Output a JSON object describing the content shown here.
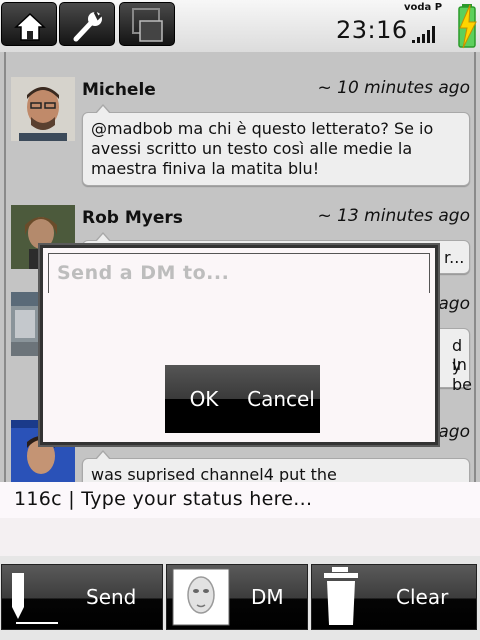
{
  "statusbar": {
    "clock": "23:16",
    "carrier": "voda P"
  },
  "topbar": {
    "home_icon": "home-icon",
    "settings_icon": "wrench-icon",
    "third_icon": "window-icon"
  },
  "tweets": [
    {
      "author": "Michele",
      "time": "~ 10 minutes ago",
      "text": "@madbob ma chi è questo letterato? Se io avessi scritto un testo così alle medie la maestra finiva la matita blu!"
    },
    {
      "author": "Rob Myers",
      "time": "~ 13 minutes ago",
      "fragment": "r..."
    },
    {
      "time": "ago",
      "fragment_a": "d In",
      "fragment_b": "y be"
    },
    {
      "time": "ago",
      "text": "was suprised channel4 put the"
    }
  ],
  "dialog": {
    "placeholder": "Send a DM to...",
    "ok_label": "OK",
    "cancel_label": "Cancel"
  },
  "status_input": {
    "text": "116c | Type your status here..."
  },
  "bottombar": {
    "send_label": "Send",
    "dm_label": "DM",
    "clear_label": "Clear"
  }
}
